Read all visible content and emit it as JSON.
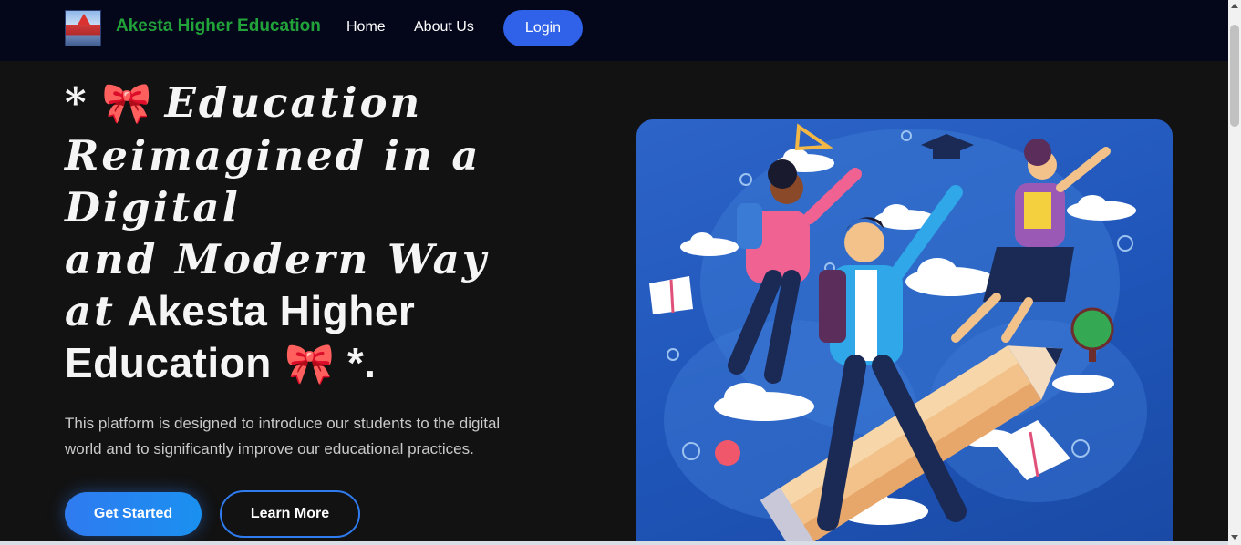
{
  "navbar": {
    "brand": "Akesta Higher Education",
    "links": [
      "Home",
      "About Us"
    ],
    "login_label": "Login"
  },
  "hero": {
    "title_lines": {
      "line1_prefix": "*",
      "line1_word": "Education",
      "line2": "Reimagined in a",
      "line3": "Digital",
      "line4": "and Modern Way",
      "line5_script": "at",
      "line5_bold": "Akesta Higher",
      "line6_bold": "Education",
      "line6_suffix": "*."
    },
    "bow_glyph": "🎀",
    "description": "This platform is designed to introduce our students to the digital world and to significantly improve our educational practices.",
    "primary_button": "Get Started",
    "secondary_button": "Learn More"
  },
  "illustration": {
    "subject": "students flying on a pencil",
    "colors": {
      "background": "#1f55b8",
      "accent": "#2f62e8",
      "brand_green": "#22a33a"
    }
  }
}
